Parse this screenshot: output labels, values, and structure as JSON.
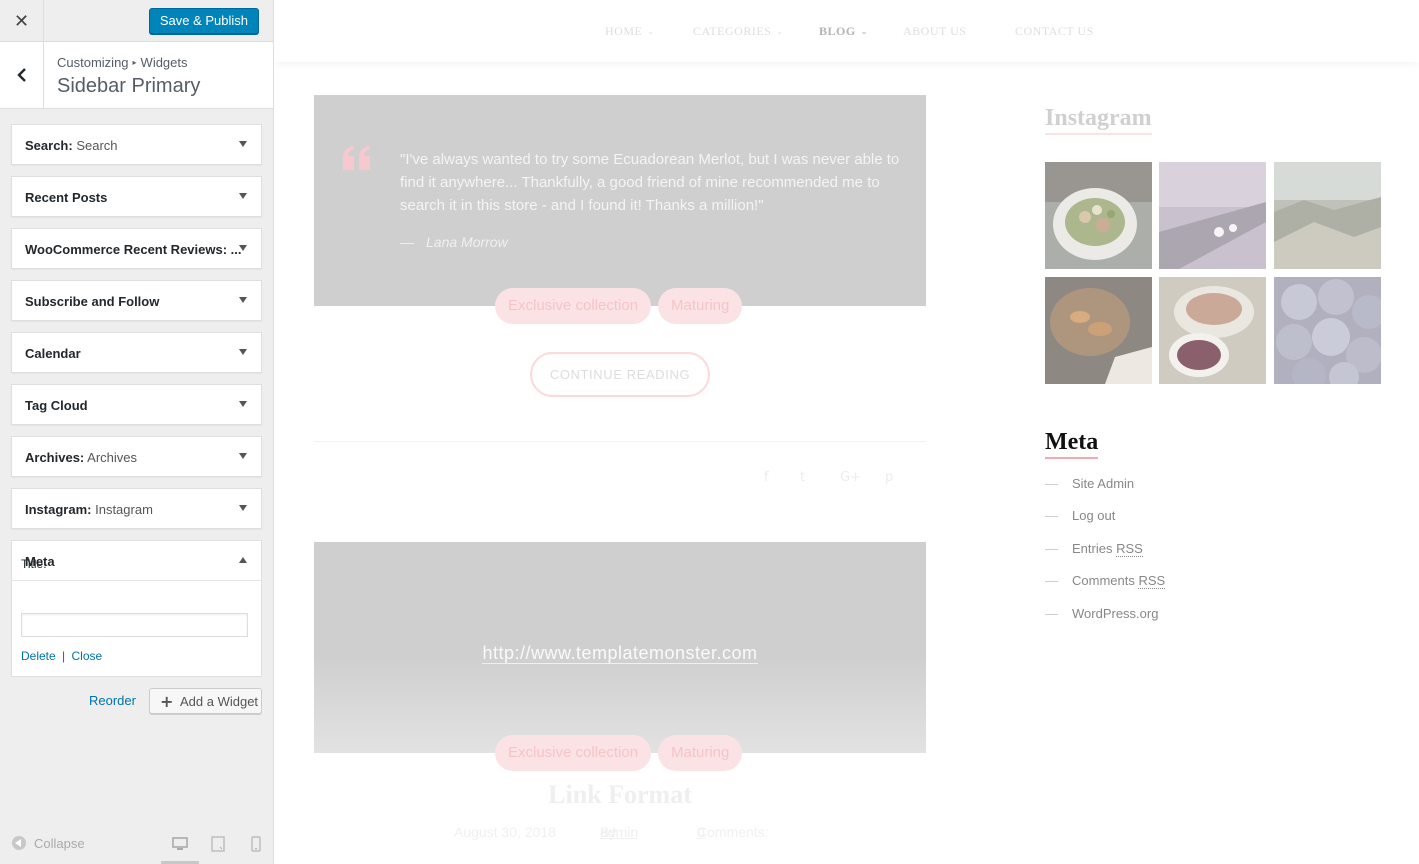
{
  "customizer": {
    "close_icon": "close-icon",
    "save_label": "Save & Publish",
    "breadcrumb": {
      "root": "Customizing",
      "separator": "▸",
      "current": "Widgets"
    },
    "section_title": "Sidebar Primary",
    "widgets": [
      {
        "type": "Search",
        "sep": ":",
        "instance": " Search"
      },
      {
        "type": "Recent Posts",
        "sep": "",
        "instance": ""
      },
      {
        "type": "WooCommerce Recent Reviews: ...",
        "sep": "",
        "instance": ""
      },
      {
        "type": "Subscribe and Follow",
        "sep": "",
        "instance": ""
      },
      {
        "type": "Calendar",
        "sep": "",
        "instance": ""
      },
      {
        "type": "Tag Cloud",
        "sep": "",
        "instance": ""
      },
      {
        "type": "Archives",
        "sep": ":",
        "instance": " Archives"
      },
      {
        "type": "Instagram",
        "sep": ":",
        "instance": " Instagram"
      }
    ],
    "open_widget": {
      "type": "Meta",
      "title_label": "Title:",
      "title_value": "",
      "delete_label": "Delete",
      "separator": "|",
      "close_label": "Close"
    },
    "reorder_label": "Reorder",
    "add_widget_label": "Add a Widget",
    "collapse_label": "Collapse"
  },
  "preview": {
    "nav": [
      {
        "label": "HOME",
        "has_submenu": true,
        "active": false
      },
      {
        "label": "CATEGORIES",
        "has_submenu": true,
        "active": false
      },
      {
        "label": "BLOG",
        "has_submenu": true,
        "active": true
      },
      {
        "label": "ABOUT US",
        "has_submenu": false,
        "active": false
      },
      {
        "label": "CONTACT US",
        "has_submenu": false,
        "active": false
      }
    ],
    "quote_post": {
      "text": "\"I've always wanted to try some Ecuadorean Merlot, but I was never able to find it anywhere... Thankfully, a good friend of mine recommended me to search it in this store - and I found it! Thanks a million!\"",
      "author_dash": "—",
      "author": "Lana Morrow",
      "tags": [
        "Exclusive collection",
        "Maturing"
      ],
      "continue_label": "CONTINUE READING"
    },
    "share_icons": [
      "facebook-icon",
      "twitter-icon",
      "google-plus-icon",
      "pinterest-icon"
    ],
    "share_glyphs": [
      "f",
      "t",
      "G+",
      "p"
    ],
    "link_post": {
      "url": "http://www.templatemonster.com",
      "tags": [
        "Exclusive collection",
        "Maturing"
      ],
      "title": "Link Format",
      "date": "August 30, 2018",
      "by_label": "By",
      "author": "admin",
      "comments_label": "Comments:",
      "comments_count": "0"
    },
    "instagram": {
      "title": "Instagram",
      "photos": [
        "salad",
        "airplane-wing",
        "rocky-coast",
        "roasted-vegetables",
        "sauce-bowl",
        "grapes"
      ]
    },
    "meta": {
      "title": "Meta",
      "dash": "—",
      "links": [
        {
          "text": "Site Admin",
          "abbr": ""
        },
        {
          "text": "Log out",
          "abbr": ""
        },
        {
          "text": "Entries ",
          "abbr": "RSS"
        },
        {
          "text": "Comments ",
          "abbr": "RSS"
        },
        {
          "text": "WordPress.org",
          "abbr": ""
        }
      ]
    }
  },
  "colors": {
    "primary_button": "#0085ba",
    "link": "#0073aa",
    "accent_pink": "#f3a9b0",
    "tag_bg": "#fbe3e5"
  }
}
